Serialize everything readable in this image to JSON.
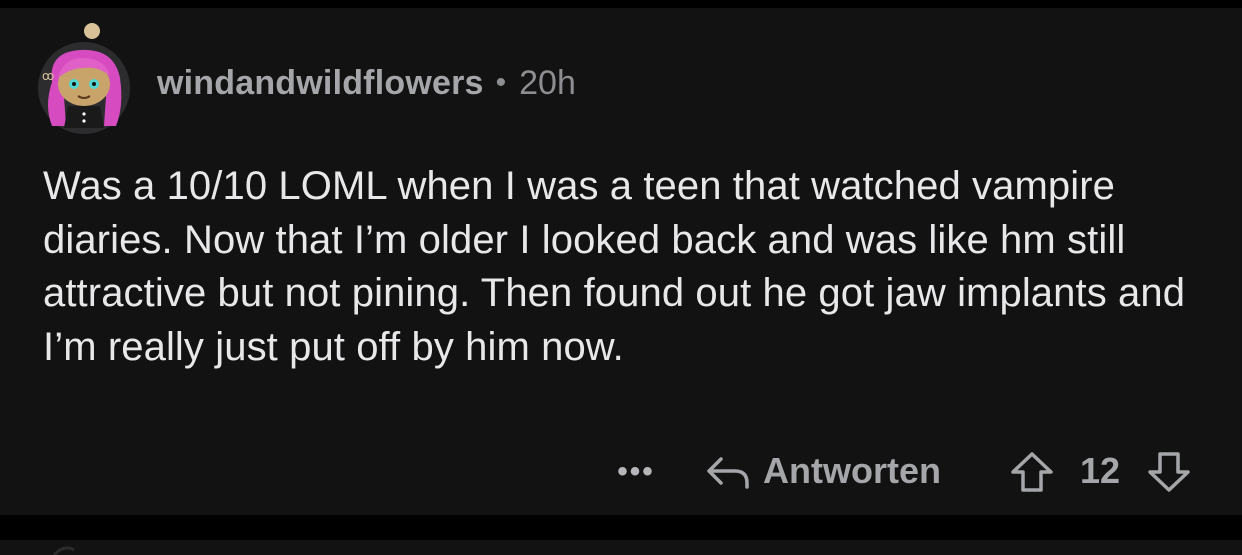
{
  "comment": {
    "username": "windandwildflowers",
    "separator": "•",
    "time_ago": "20h",
    "text": "Was a 10/10 LOML when I was a teen that watched vampire diaries. Now that I’m older I looked back and was like hm still attractive but not pining. Then found out he got jaw implants and I’m really just put off by him now.",
    "avatar_icon": "snoo-avatar-pink-hair",
    "actions": {
      "more_label": "•••",
      "more_icon": "more-options-icon",
      "reply_label": "Antworten",
      "reply_icon": "reply-arrow-icon",
      "upvote_icon": "upvote-arrow-icon",
      "score": "12",
      "downvote_icon": "downvote-arrow-icon"
    }
  },
  "colors": {
    "page_background": "#000000",
    "card_background": "#121212",
    "body_text": "#e8e8ea",
    "meta_text": "#8d8e91",
    "action_text": "#a5a6a9",
    "avatar_hair": "#d64bc0",
    "avatar_skin": "#c9a46a"
  }
}
